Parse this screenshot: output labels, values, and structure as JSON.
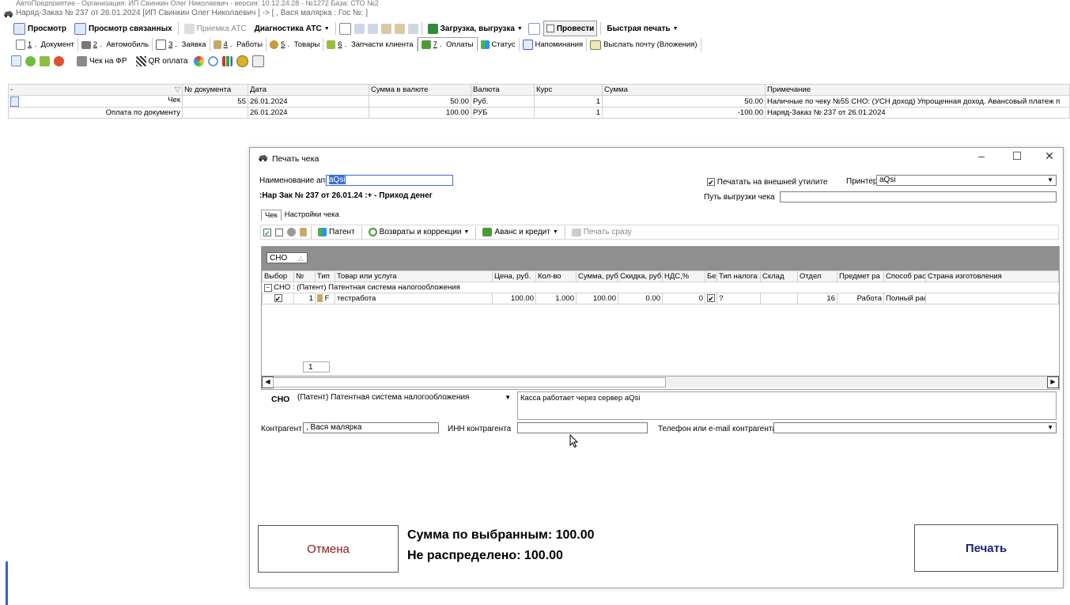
{
  "app": {
    "faded_title": "АвтоПредприятие - Организация: ИП Свинкин Олег Николаевич - версия: 10.12.24.28 - №1272 База: СТО №2",
    "window_title": "Наряд-Заказ № 237  от 26.01.2024 [ИП Свинкин Олег Николаевич ] -> [ , Вася малярка : Гос №:  ]"
  },
  "toolbar1": {
    "view": "Просмотр",
    "view_related": "Просмотр связанных",
    "reception_ats": "Приемка АТС",
    "diagnostics_ats": "Диагностика АТС",
    "load_unload": "Загрузка, выгрузка",
    "post": "Провести",
    "quick_print": "Быстрая печать"
  },
  "tabs": [
    {
      "num": "1",
      "label": "Документ"
    },
    {
      "num": "2",
      "label": "Автомобиль"
    },
    {
      "num": "3",
      "label": "Заявка"
    },
    {
      "num": "4",
      "label": "Работы"
    },
    {
      "num": "5",
      "label": "Товары"
    },
    {
      "num": "6",
      "label": "Запчасти клиента"
    },
    {
      "num": "7",
      "label": "Оплаты"
    },
    {
      "num": "",
      "label": "Статус"
    },
    {
      "num": "",
      "label": "Напоминания"
    },
    {
      "num": "",
      "label": "Выслать почту (Вложения)"
    }
  ],
  "toolbar2": {
    "check_fr": "Чек на ФР",
    "qr_payment": "QR оплата"
  },
  "payments_grid": {
    "columns": [
      "-",
      "№ документа",
      "Дата",
      "Сумма в валюте",
      "Валюта",
      "Курс",
      "Сумма",
      "Примечание"
    ],
    "rows": [
      {
        "type": "Чек",
        "doc": "55",
        "date": "26.01.2024",
        "amount_cur": "50.00",
        "currency": "Руб.",
        "rate": "1",
        "sum": "50.00",
        "note": "Наличные по чеку №55 СНО: (УСН доход) Упрощенная доход. Авансовый платеж п"
      },
      {
        "type": "Оплата по документу",
        "doc": "",
        "date": "26.01.2024",
        "amount_cur": "100.00",
        "currency": "РУБ",
        "rate": "1",
        "sum": "-100.00",
        "note": "Наряд-Заказ №  237  от 26.01.2024"
      }
    ]
  },
  "dialog": {
    "title": "Печать чека",
    "device_label": "Наименование аппарата",
    "device_value": "aQsi",
    "print_external_label": "Печатать на внешней утилите",
    "printer_label": "Принтер",
    "printer_value": "aQsi",
    "doc_caption": ":Нар Зак № 237 от 26.01.24 :+ - Приход денег",
    "export_path_label": "Путь выгрузки чека",
    "tab_check": "Чек",
    "tab_settings": "Настройки чека",
    "btn_patent": "Патент",
    "btn_returns": "Возвраты и коррекции",
    "btn_advance": "Аванс и кредит",
    "btn_print_now": "Печать сразу",
    "group_field": "СНО",
    "grid_columns": [
      "Выбор",
      "№",
      "Тип",
      "Товар или услуга",
      "Цена, руб.",
      "Кол-во",
      "Сумма, руб",
      "Скидка, руб",
      "НДС,%",
      "Бе",
      "Тип налога",
      "Склад",
      "Отдел",
      "Предмет ра",
      "Способ рас",
      "Страна изготовления"
    ],
    "group_row": "СНО : (Патент) Патентная система налогообложения",
    "items": [
      {
        "num": "1",
        "type": "F",
        "name": "тестработа",
        "price": "100.00",
        "qty": "1.000",
        "sum": "100.00",
        "discount": "0.00",
        "vat": "0",
        "tax_type": "?",
        "warehouse": "",
        "dept": "16",
        "subject": "Работа",
        "method": "Полный рас",
        "country": ""
      }
    ],
    "row_count": "1",
    "sno_label": "СНО",
    "sno_value": "(Патент) Патентная система налогообложения",
    "info_text": "Касса работает через сервер aQsi",
    "counterparty_label": "Контрагент",
    "counterparty_value": ", Вася малярка",
    "inn_label": "ИНН контрагента",
    "inn_value": "",
    "phone_label": "Телефон или e-mail контрагента",
    "phone_value": "",
    "cancel": "Отмена",
    "sum_selected": "Сумма по выбранным: 100.00",
    "not_distributed": "Не распределено: 100.00",
    "print": "Печать"
  },
  "colors": {
    "cancel_text": "#8b1a1a",
    "print_text": "#1a237e",
    "group_panel": "#8f8f8f"
  }
}
